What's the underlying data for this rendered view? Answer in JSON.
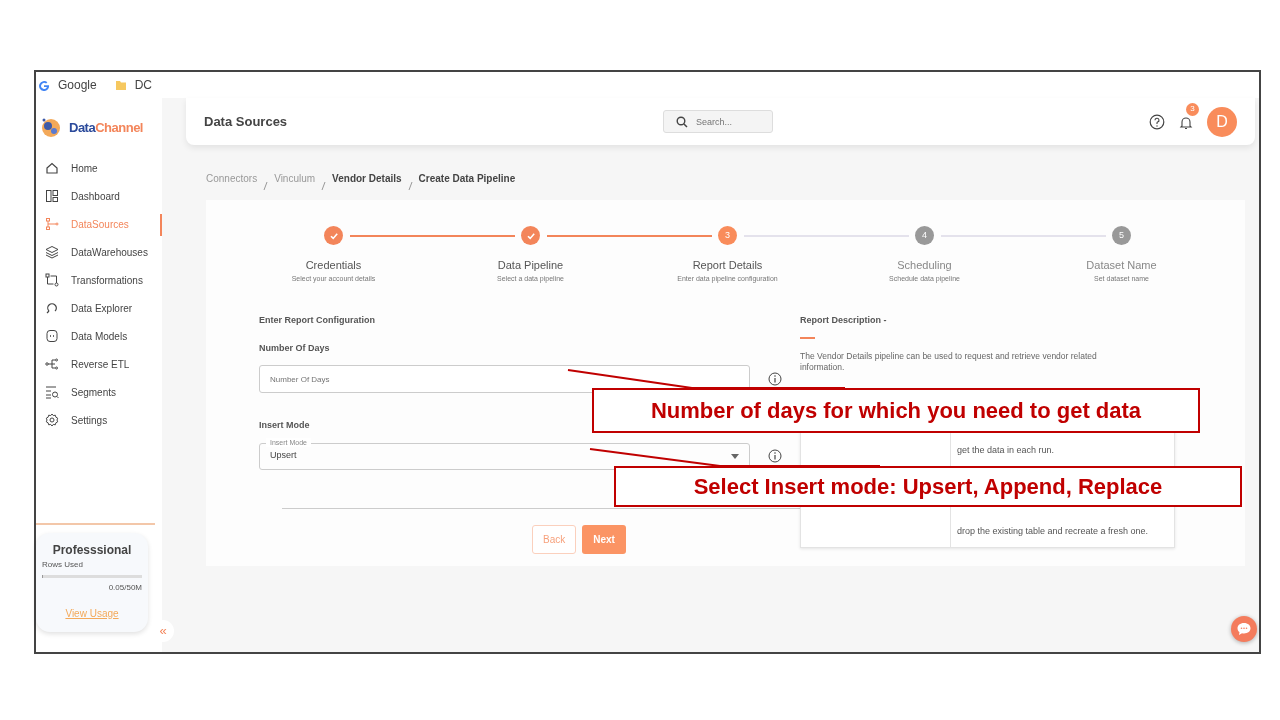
{
  "bookmarks": [
    {
      "kind": "google",
      "label": "Google"
    },
    {
      "kind": "folder",
      "label": "DC"
    }
  ],
  "sidebar": {
    "logo": {
      "part1": "Data",
      "part2": "Channel"
    },
    "items": [
      {
        "label": "Home",
        "selected": false
      },
      {
        "label": "Dashboard",
        "selected": false
      },
      {
        "label": "DataSources",
        "selected": true
      },
      {
        "label": "DataWarehouses",
        "selected": false
      },
      {
        "label": "Transformations",
        "selected": false
      },
      {
        "label": "Data Explorer",
        "selected": false
      },
      {
        "label": "Data Models",
        "selected": false
      },
      {
        "label": "Reverse ETL",
        "selected": false
      },
      {
        "label": "Segments",
        "selected": false
      },
      {
        "label": "Settings",
        "selected": false
      }
    ],
    "plan": {
      "name": "Professsional",
      "usage_label": "Rows Used",
      "level": 0.001,
      "usage": "0.05/50M",
      "link": "View Usage"
    },
    "collapse": "«"
  },
  "header": {
    "title": "Data Sources",
    "search_placeholder": "Search...",
    "notifications": "3",
    "avatar": "D"
  },
  "breadcrumb": [
    {
      "label": "Connectors",
      "current": false
    },
    {
      "label": "Vinculum",
      "current": false
    },
    {
      "label": "Vendor Details",
      "current": true
    },
    {
      "label": "Create Data Pipeline",
      "current": true
    }
  ],
  "steps": [
    {
      "done": true,
      "active": true,
      "title": "Credentials",
      "subtitle": "Select your account details"
    },
    {
      "done": true,
      "active": true,
      "title": "Data Pipeline",
      "subtitle": "Select a data pipeline"
    },
    {
      "done": false,
      "active": true,
      "number": "3",
      "title": "Report Details",
      "subtitle": "Enter data pipeline configuration"
    },
    {
      "done": false,
      "active": false,
      "number": "4",
      "title": "Scheduling",
      "subtitle": "Schedule data pipeline"
    },
    {
      "done": false,
      "active": false,
      "number": "5",
      "title": "Dataset Name",
      "subtitle": "Set dataset name"
    }
  ],
  "form": {
    "heading": "Enter Report Configuration",
    "fields": [
      {
        "kind": "text",
        "label": "Number Of Days",
        "placeholder": "Number Of Days"
      },
      {
        "kind": "select",
        "label": "Insert Mode",
        "floating_label": "Insert Mode",
        "value": "Upsert"
      }
    ],
    "buttons": [
      {
        "kind": "outline",
        "label": "Back"
      },
      {
        "kind": "primary",
        "label": "Next"
      }
    ]
  },
  "description": {
    "title": "Report Description -",
    "text": "The Vendor Details pipeline can be used to request and retrieve vendor related information.",
    "rows": [
      {
        "description": "get the data in each run."
      },
      {
        "description": "drop the existing table and recreate a fresh one."
      }
    ]
  },
  "callouts": [
    "Number of days for which you need to get data",
    "Select Insert mode: Upsert, Append, Replace"
  ]
}
